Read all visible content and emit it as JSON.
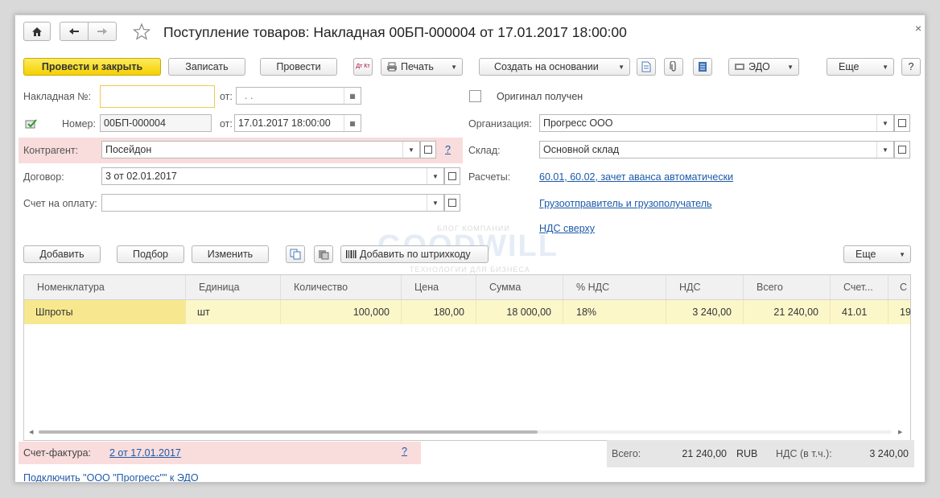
{
  "window": {
    "title": "Поступление товаров: Накладная 00БП-000004 от 17.01.2017 18:00:00",
    "close": "×"
  },
  "toolbar": {
    "post_close": "Провести и закрыть",
    "save": "Записать",
    "post": "Провести",
    "print": "Печать",
    "create_based": "Создать на основании",
    "edo": "ЭДО",
    "more": "Еще",
    "help": "?",
    "dt_kt": "Дт Кт"
  },
  "form": {
    "invoice_no_label": "Накладная №:",
    "invoice_no_value": "",
    "from_label": "от:",
    "invoice_date_value": ". .",
    "number_label": "Номер:",
    "number_value": "00БП-000004",
    "from_label2": "от:",
    "date_value": "17.01.2017 18:00:00",
    "contractor_label": "Контрагент:",
    "contractor_value": "Посейдон",
    "contractor_help": "?",
    "contract_label": "Договор:",
    "contract_value": "3 от 02.01.2017",
    "payment_label": "Счет на оплату:",
    "payment_value": "",
    "original_label": "Оригинал получен",
    "org_label": "Организация:",
    "org_value": "Прогресс ООО",
    "warehouse_label": "Склад:",
    "warehouse_value": "Основной склад",
    "settlements_label": "Расчеты:",
    "settlements_link": "60.01, 60.02, зачет аванса автоматически",
    "shipper_link": "Грузоотправитель и грузополучатель",
    "vat_link": "НДС сверху"
  },
  "table_toolbar": {
    "add": "Добавить",
    "pick": "Подбор",
    "change": "Изменить",
    "barcode": "Добавить по штрихкоду",
    "more": "Еще"
  },
  "watermark": {
    "small_top": "БЛОГ КОМПАНИИ",
    "main": "GOODWILL",
    "small_bottom": "ТЕХНОЛОГИИ ДЛЯ БИЗНЕСА"
  },
  "table": {
    "columns": [
      "Номенклатура",
      "Единица",
      "Количество",
      "Цена",
      "Сумма",
      "% НДС",
      "НДС",
      "Всего",
      "Счет...",
      "С"
    ],
    "rows": [
      [
        "Шпроты",
        "шт",
        "100,000",
        "180,00",
        "18 000,00",
        "18%",
        "3 240,00",
        "21 240,00",
        "41.01",
        "19"
      ]
    ]
  },
  "footer": {
    "invoice_label": "Счет-фактура:",
    "invoice_link": "2 от 17.01.2017",
    "invoice_help": "?",
    "total_label": "Всего:",
    "total_value": "21 240,00",
    "currency": "RUB",
    "vat_label": "НДС (в т.ч.):",
    "vat_value": "3 240,00",
    "edo_link": "Подключить \"ООО \"Прогресс\"\" к ЭДО"
  },
  "colors": {
    "primary_button": "#f5d000",
    "highlight": "#f9dcdc",
    "selected_row": "#fbf7c9",
    "link": "#1d5aa8"
  }
}
